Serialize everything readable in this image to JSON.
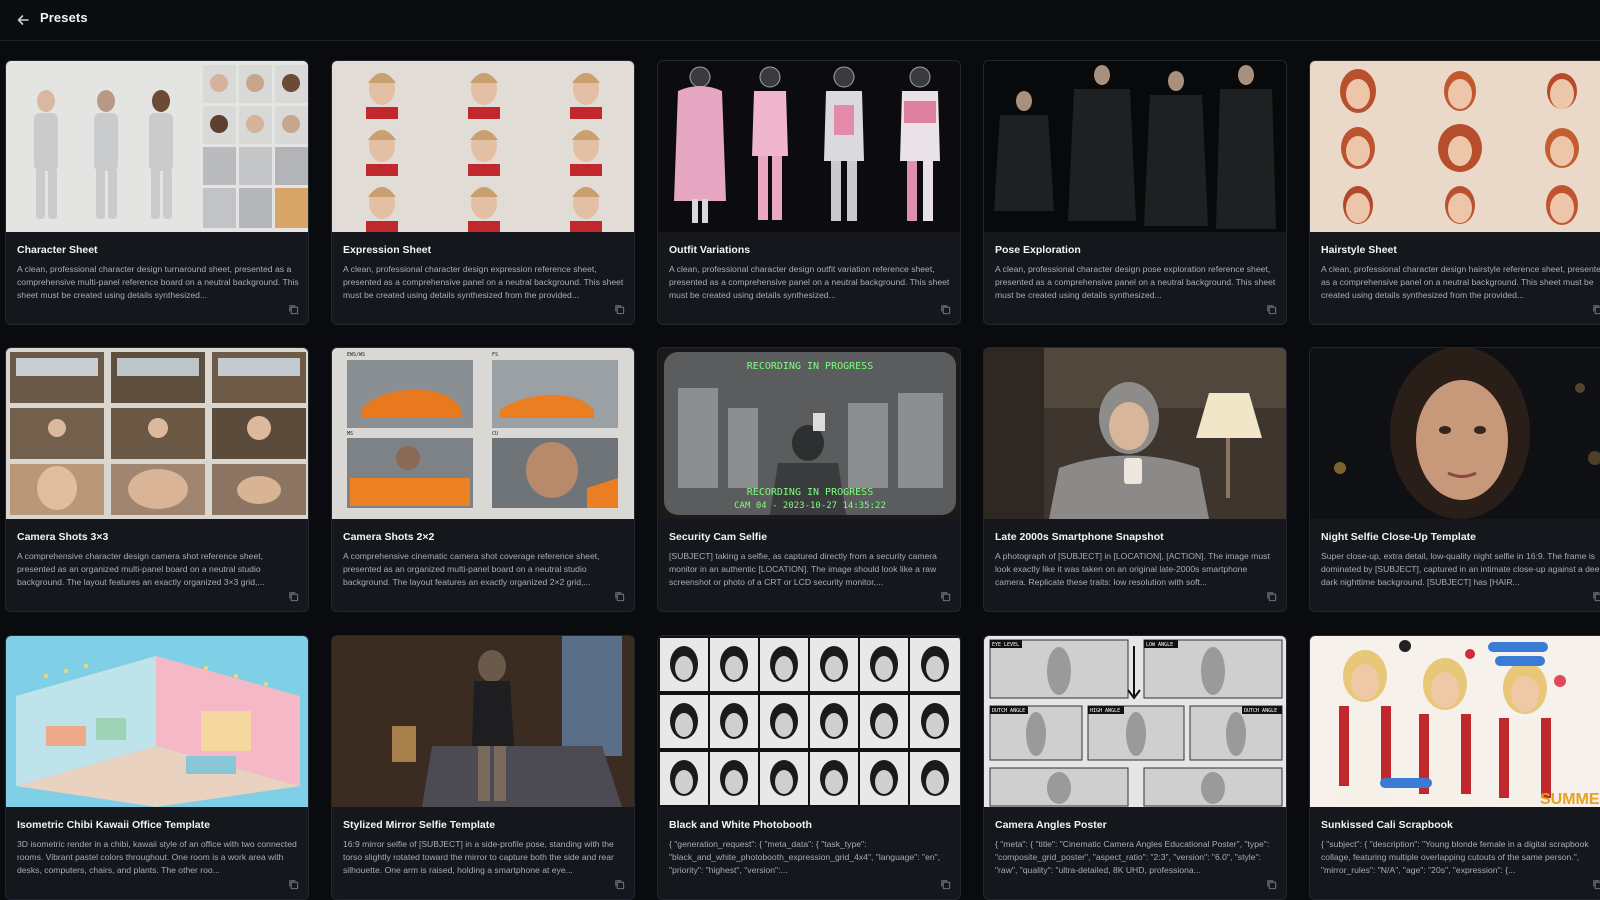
{
  "header": {
    "title": "Presets",
    "back_icon": "arrow-left-icon"
  },
  "presets": [
    {
      "title": "Character Sheet",
      "description": "A clean, professional character design turnaround sheet, presented as a comprehensive multi-panel reference board on a neutral background. This sheet must be created using details synthesized..."
    },
    {
      "title": "Expression Sheet",
      "description": "A clean, professional character design expression reference sheet, presented as a comprehensive panel on a neutral background. This sheet must be created using details synthesized from the provided..."
    },
    {
      "title": "Outfit Variations",
      "description": "A clean, professional character design outfit variation reference sheet, presented as a comprehensive panel on a neutral background. This sheet must be created using details synthesized..."
    },
    {
      "title": "Pose Exploration",
      "description": "A clean, professional character design pose exploration reference sheet, presented as a comprehensive panel on a neutral background. This sheet must be created using details synthesized..."
    },
    {
      "title": "Hairstyle Sheet",
      "description": "A clean, professional character design hairstyle reference sheet, presented as a comprehensive panel on a neutral background. This sheet must be created using details synthesized from the provided..."
    },
    {
      "title": "Camera Shots 3×3",
      "description": "A comprehensive character design camera shot reference sheet, presented as an organized multi-panel board on a neutral studio background. The layout features an exactly organized 3×3 grid,..."
    },
    {
      "title": "Camera Shots 2×2",
      "description": "A comprehensive cinematic camera shot coverage reference sheet, presented as an organized multi-panel board on a neutral studio background. The layout features an exactly organized 2×2 grid,...",
      "labels": [
        "EWS/WS",
        "FS",
        "MS",
        "CU"
      ]
    },
    {
      "title": "Security Cam Selfie",
      "description": "[SUBJECT] taking a selfie, as captured directly from a security camera monitor in an authentic [LOCATION]. The image should look like a raw screenshot or photo of a CRT or LCD security monitor,...",
      "overlay_top": "RECORDING IN PROGRESS",
      "overlay_bottom_1": "RECORDING IN PROGRESS",
      "overlay_bottom_2": "CAM 04 - 2023-10-27 14:35:22"
    },
    {
      "title": "Late 2000s Smartphone Snapshot",
      "description": "A photograph of [SUBJECT] in [LOCATION], [ACTION]. The image must look exactly like it was taken on an original late-2000s smartphone camera. Replicate these traits: low resolution with soft..."
    },
    {
      "title": "Night Selfie Close-Up Template",
      "description": "Super close-up, extra detail, low-quality night selfie in 16:9. The frame is dominated by [SUBJECT], captured in an intimate close-up against a deep dark nighttime background. [SUBJECT] has [HAIR..."
    },
    {
      "title": "Isometric Chibi Kawaii Office Template",
      "description": "3D isometric render in a chibi, kawaii style of an office with two connected rooms. Vibrant pastel colors throughout. One room is a work area with desks, computers, chairs, and plants. The other roo..."
    },
    {
      "title": "Stylized Mirror Selfie Template",
      "description": "16:9 mirror selfie of [SUBJECT] in a side-profile pose, standing with the torso slightly rotated toward the mirror to capture both the side and rear silhouette. One arm is raised, holding a smartphone at eye..."
    },
    {
      "title": "Black and White Photobooth",
      "description": "{ \"generation_request\": { \"meta_data\": { \"task_type\": \"black_and_white_photobooth_expression_grid_4x4\", \"language\": \"en\", \"priority\": \"highest\", \"version\":..."
    },
    {
      "title": "Camera Angles Poster",
      "description": "{ \"meta\": { \"title\": \"Cinematic Camera Angles Educational Poster\", \"type\": \"composite_grid_poster\", \"aspect_ratio\": \"2:3\", \"version\": \"6.0\", \"style\": \"raw\", \"quality\": \"ultra-detailed, 8K UHD, professiona...",
      "labels": [
        "EYE LEVEL",
        "LOW ANGLE",
        "DUTCH ANGLE",
        "HIGH ANGLE",
        "DUTCH ANGLE"
      ]
    },
    {
      "title": "Sunkissed Cali Scrapbook",
      "description": "{ \"subject\": { \"description\": \"Young blonde female in a digital scrapbook collage, featuring multiple overlapping cutouts of the same person.\", \"mirror_rules\": \"N/A\", \"age\": \"20s\", \"expression\": {...",
      "labels": [
        "SUMMER"
      ]
    }
  ]
}
